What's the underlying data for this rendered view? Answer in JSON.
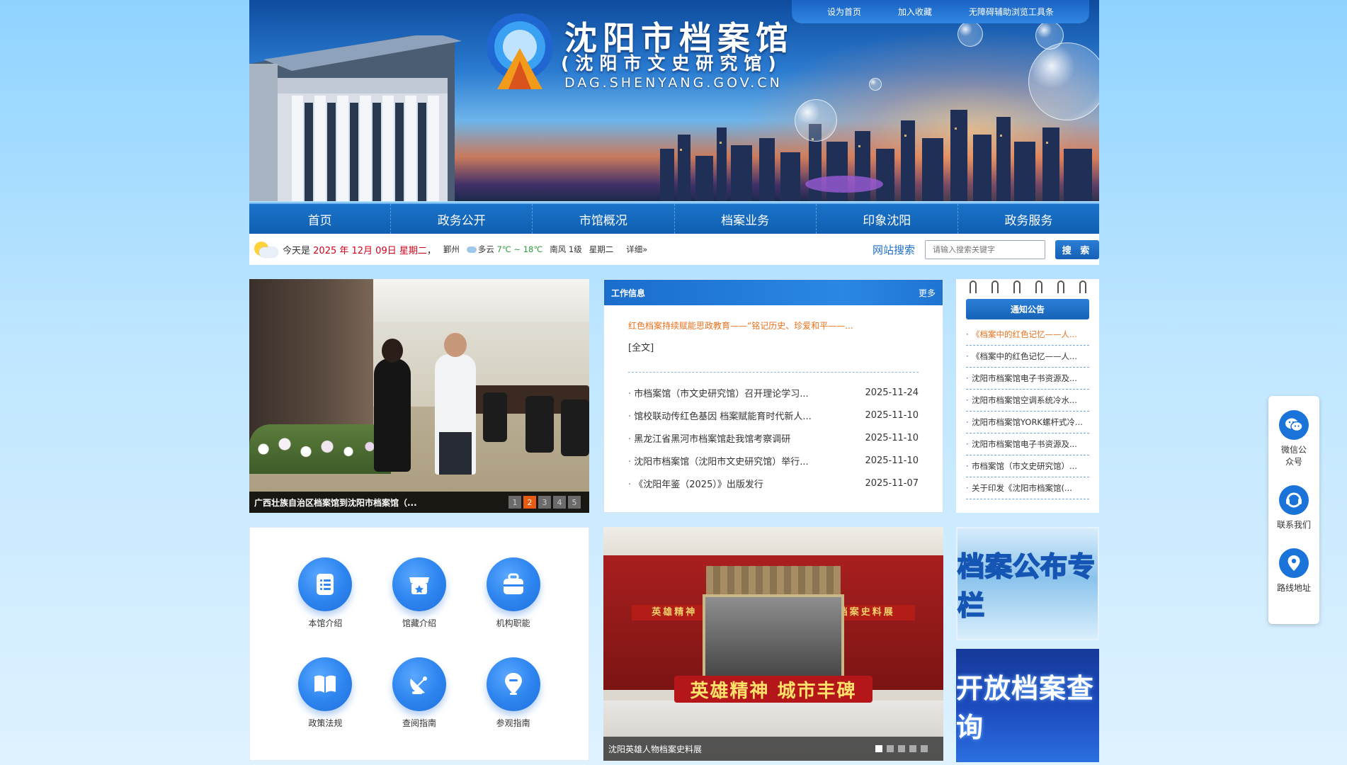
{
  "header": {
    "site_title": "沈阳市档案馆",
    "site_subtitle": "(沈阳市文史研究馆)",
    "site_domain": "DAG.SHENYANG.GOV.CN",
    "top_links": [
      "设为首页",
      "加入收藏",
      "无障碍辅助浏览工具条"
    ]
  },
  "nav": [
    "首页",
    "政务公开",
    "市馆概况",
    "档案业务",
    "印象沈阳",
    "政务服务"
  ],
  "infobar": {
    "today_prefix": "今天是",
    "date": "2025 年 12月 09日 星期二",
    "city": "鄞州",
    "weather": "多云",
    "temp": "7℃ ~ 18℃",
    "wind": "南风 1级",
    "weekday": "星期二",
    "detail": "详细»",
    "search_label": "网站搜索",
    "search_placeholder": "请输入搜索关键字",
    "search_button": "搜 索"
  },
  "slider1": {
    "caption": "广西壮族自治区档案馆到沈阳市档案馆（...",
    "pages": [
      "1",
      "2",
      "3",
      "4",
      "5"
    ],
    "active_page": 2
  },
  "work": {
    "title": "工作信息",
    "more": "更多",
    "headline": "红色档案持续赋能思政教育——“铭记历史、珍爱和平——...",
    "fulltext": "[全文]",
    "items": [
      {
        "title": "市档案馆（市文史研究馆）召开理论学习...",
        "date": "2025-11-24"
      },
      {
        "title": "馆校联动传红色基因 档案赋能育时代新人...",
        "date": "2025-11-10"
      },
      {
        "title": "黑龙江省黑河市档案馆赴我馆考察调研",
        "date": "2025-11-10"
      },
      {
        "title": "沈阳市档案馆（沈阳市文史研究馆）举行...",
        "date": "2025-11-10"
      },
      {
        "title": "《沈阳年鉴（2025）》出版发行",
        "date": "2025-11-07"
      }
    ]
  },
  "notice": {
    "title": "通知公告",
    "items": [
      "《档案中的红色记忆——人...",
      "《档案中的红色记忆——人...",
      "沈阳市档案馆电子书资源及...",
      "沈阳市档案馆空调系统冷水...",
      "沈阳市档案馆YORK螺杆式冷...",
      "沈阳市档案馆电子书资源及...",
      "市档案馆（市文史研究馆）...",
      "关于印发《沈阳市档案馆(..."
    ]
  },
  "icons": [
    {
      "label": "本馆介绍",
      "icon": "document-list-icon"
    },
    {
      "label": "馆藏介绍",
      "icon": "store-icon"
    },
    {
      "label": "机构职能",
      "icon": "briefcase-icon"
    },
    {
      "label": "政策法规",
      "icon": "book-icon"
    },
    {
      "label": "查阅指南",
      "icon": "satellite-dish-icon"
    },
    {
      "label": "参观指南",
      "icon": "map-pin-icon"
    }
  ],
  "slider2": {
    "wall_text": "英雄精神 城市丰碑——沈阳英雄人物档案史料展",
    "banner_text": "英雄精神 城市丰碑",
    "caption": "沈阳英雄人物档案史料展",
    "dots": 5,
    "active_dot": 1
  },
  "features": {
    "feature1": "档案公布专栏",
    "feature2": "开放档案查询"
  },
  "float": [
    {
      "label": "微信公众号",
      "icon": "wechat-icon"
    },
    {
      "label": "联系我们",
      "icon": "headset-icon"
    },
    {
      "label": "路线地址",
      "icon": "location-icon"
    }
  ]
}
